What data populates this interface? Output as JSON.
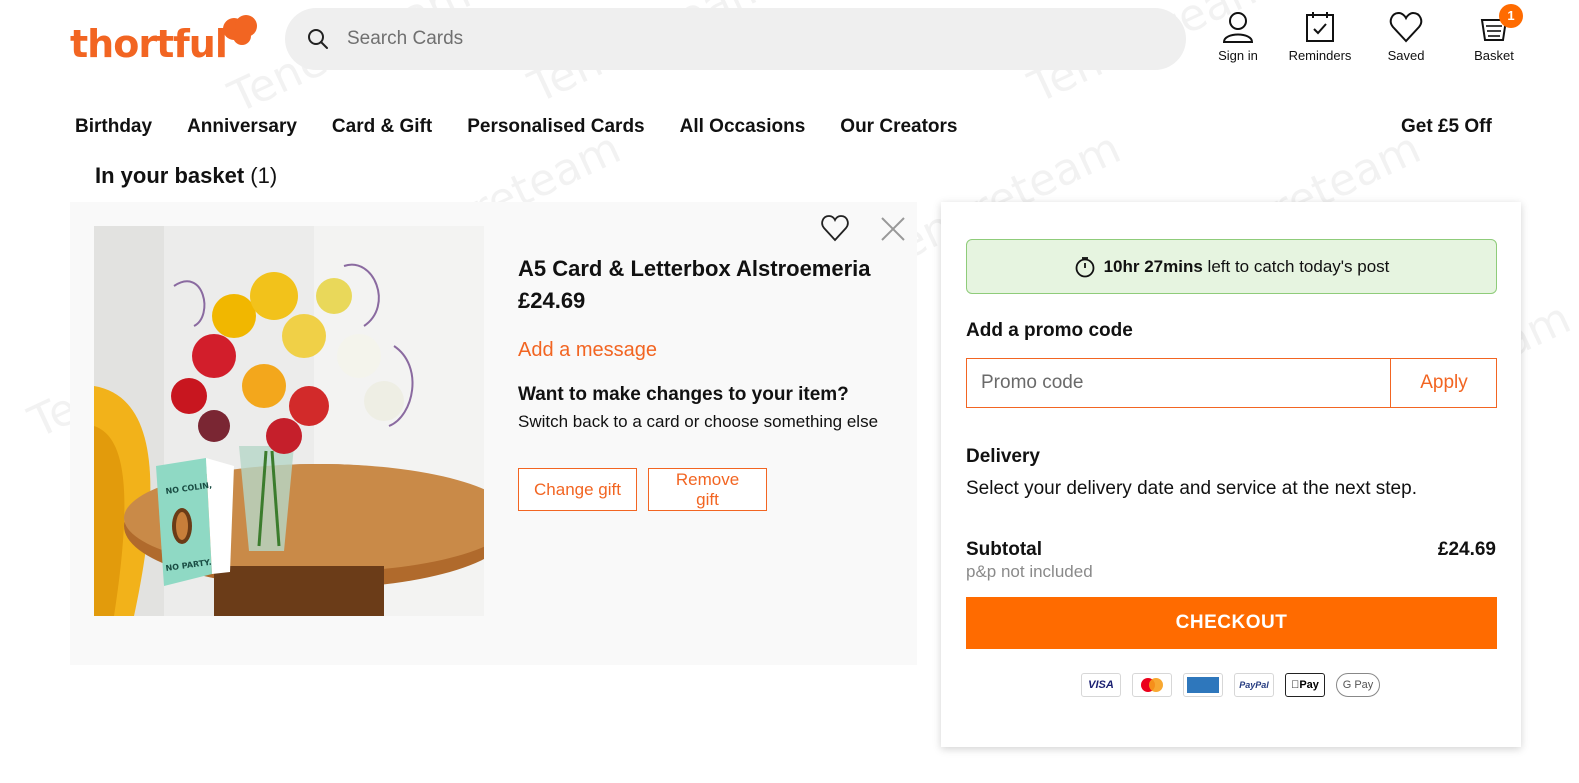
{
  "brand": {
    "logo_text": "thortful",
    "accent": "#f26522",
    "checkout_color": "#ff6b00"
  },
  "search": {
    "placeholder": "Search Cards"
  },
  "header_actions": [
    {
      "label": "Sign in",
      "icon": "user-icon"
    },
    {
      "label": "Reminders",
      "icon": "calendar-check-icon"
    },
    {
      "label": "Saved",
      "icon": "heart-icon"
    },
    {
      "label": "Basket",
      "icon": "basket-icon",
      "badge": "1"
    }
  ],
  "nav": {
    "items": [
      "Birthday",
      "Anniversary",
      "Card & Gift",
      "Personalised Cards",
      "All Occasions",
      "Our Creators"
    ],
    "promo": "Get £5 Off"
  },
  "basket": {
    "title": "In your basket",
    "count": "(1)"
  },
  "item": {
    "title": "A5 Card & Letterbox Alstroemeria",
    "price": "£24.69",
    "add_message": "Add a message",
    "changes_heading": "Want to make changes to your item?",
    "changes_text": "Switch back to a card or choose something else",
    "change_gift": "Change gift",
    "remove_gift": "Remove gift",
    "card_text_top": "NO COLIN,",
    "card_text_bottom": "NO PARTY."
  },
  "summary": {
    "post_time": "10hr 27mins",
    "post_suffix": "left to catch today's post",
    "promo_heading": "Add a promo code",
    "promo_placeholder": "Promo code",
    "apply": "Apply",
    "delivery_heading": "Delivery",
    "delivery_text": "Select your delivery date and service at the next step.",
    "subtotal_label": "Subtotal",
    "subtotal_value": "£24.69",
    "pp_note": "p&p not included",
    "checkout": "CHECKOUT",
    "payment_methods": [
      "VISA",
      "MasterCard",
      "AMEX",
      "PayPal",
      "Pay",
      "G Pay"
    ]
  },
  "watermark": "Tenereteam"
}
